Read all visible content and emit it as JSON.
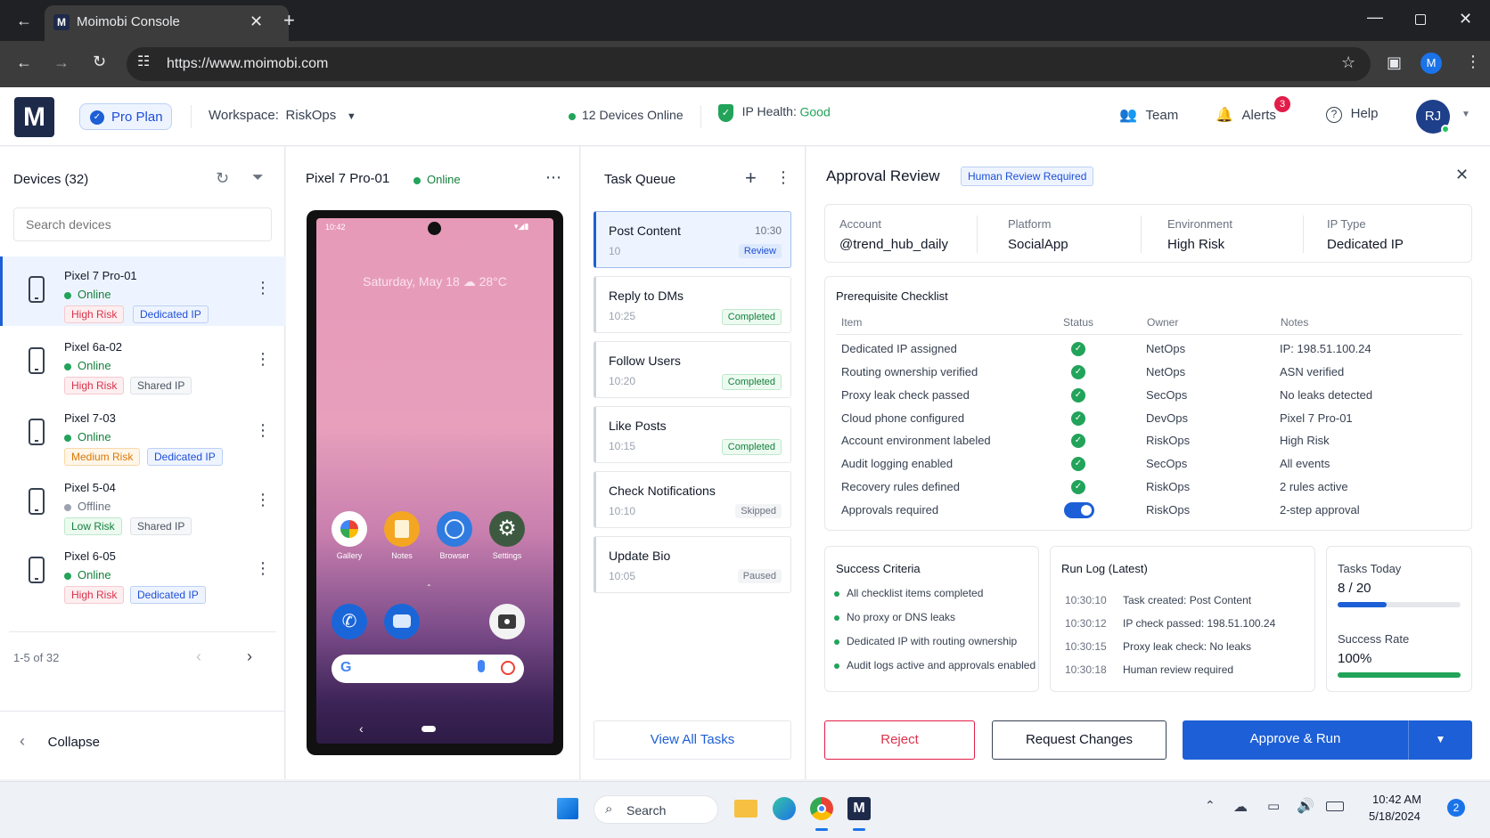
{
  "browser": {
    "tab_title": "Moimobi Console",
    "url": "https://www.moimobi.com",
    "profile_initial": "M"
  },
  "header": {
    "logo": "M",
    "plan": "Pro Plan",
    "workspace_label": "Workspace:",
    "workspace": "RiskOps",
    "devices_online": "12 Devices Online",
    "ip_health_label": "IP Health:",
    "ip_health_value": "Good",
    "team": "Team",
    "alerts": "Alerts",
    "alerts_count": "3",
    "help": "Help",
    "avatar": "RJ"
  },
  "devices": {
    "title": "Devices (32)",
    "search_placeholder": "Search devices",
    "items": [
      {
        "name": "Pixel 7 Pro-01",
        "status": "Online",
        "risk": "High Risk",
        "ip": "Dedicated IP"
      },
      {
        "name": "Pixel 6a-02",
        "status": "Online",
        "risk": "High Risk",
        "ip": "Shared IP"
      },
      {
        "name": "Pixel 7-03",
        "status": "Online",
        "risk": "Medium Risk",
        "ip": "Dedicated IP"
      },
      {
        "name": "Pixel 5-04",
        "status": "Offline",
        "risk": "Low Risk",
        "ip": "Shared IP"
      },
      {
        "name": "Pixel 6-05",
        "status": "Online",
        "risk": "High Risk",
        "ip": "Dedicated IP"
      }
    ],
    "pagination": "1-5 of 32",
    "collapse": "Collapse"
  },
  "phone_panel": {
    "device": "Pixel 7 Pro-01",
    "status": "Online",
    "screen": {
      "time": "10:42",
      "date_weather": "Saturday, May 18  ☁ 28°C",
      "apps": [
        "Gallery",
        "Notes",
        "Browser",
        "Settings"
      ]
    }
  },
  "task_queue": {
    "title": "Task Queue",
    "tasks": [
      {
        "title": "Post Content",
        "time": "10",
        "time_right": "10:30",
        "status": "Review"
      },
      {
        "title": "Reply to DMs",
        "time": "10:25",
        "status": "Completed"
      },
      {
        "title": "Follow Users",
        "time": "10:20",
        "status": "Completed"
      },
      {
        "title": "Like Posts",
        "time": "10:15",
        "status": "Completed"
      },
      {
        "title": "Check Notifications",
        "time": "10:10",
        "status": "Skipped"
      },
      {
        "title": "Update Bio",
        "time": "10:05",
        "status": "Paused"
      }
    ],
    "view_all": "View All Tasks"
  },
  "approval": {
    "title": "Approval Review",
    "tag": "Human Review Required",
    "summary": [
      {
        "label": "Account",
        "value": "@trend_hub_daily"
      },
      {
        "label": "Platform",
        "value": "SocialApp"
      },
      {
        "label": "Environment",
        "value": "High Risk"
      },
      {
        "label": "IP Type",
        "value": "Dedicated IP"
      }
    ],
    "checklist_title": "Prerequisite Checklist",
    "columns": [
      "Item",
      "Status",
      "Owner",
      "Notes"
    ],
    "checklist": [
      {
        "item": "Dedicated IP assigned",
        "owner": "NetOps",
        "notes": "IP: 198.51.100.24"
      },
      {
        "item": "Routing ownership verified",
        "owner": "NetOps",
        "notes": "ASN verified"
      },
      {
        "item": "Proxy leak check passed",
        "owner": "SecOps",
        "notes": "No leaks detected"
      },
      {
        "item": "Cloud phone configured",
        "owner": "DevOps",
        "notes": "Pixel 7 Pro-01"
      },
      {
        "item": "Account environment labeled",
        "owner": "RiskOps",
        "notes": "High Risk"
      },
      {
        "item": "Audit logging enabled",
        "owner": "SecOps",
        "notes": "All events"
      },
      {
        "item": "Recovery rules defined",
        "owner": "RiskOps",
        "notes": "2 rules active"
      },
      {
        "item": "Approvals required",
        "owner": "RiskOps",
        "notes": "2-step approval"
      }
    ],
    "success_title": "Success Criteria",
    "success": [
      "All checklist items completed",
      "No proxy or DNS leaks",
      "Dedicated IP with routing ownership",
      "Audit logs active and approvals enabled"
    ],
    "runlog_title": "Run Log (Latest)",
    "runlog": [
      {
        "time": "10:30:10",
        "text": "Task created: Post Content"
      },
      {
        "time": "10:30:12",
        "text": "IP check passed: 198.51.100.24"
      },
      {
        "time": "10:30:15",
        "text": "Proxy leak check: No leaks"
      },
      {
        "time": "10:30:18",
        "text": "Human review required"
      }
    ],
    "tasks_today_label": "Tasks Today",
    "tasks_today_value": "8 / 20",
    "tasks_today_fraction": 0.4,
    "success_rate_label": "Success Rate",
    "success_rate_value": "100%",
    "success_rate_fraction": 1.0,
    "reject": "Reject",
    "request_changes": "Request Changes",
    "approve": "Approve & Run"
  },
  "taskbar": {
    "search": "Search",
    "time": "10:42 AM",
    "date": "5/18/2024",
    "notifications": "2"
  },
  "colors": {
    "primary": "#1d5fd6",
    "success": "#22a35a",
    "danger": "#d9344c"
  }
}
